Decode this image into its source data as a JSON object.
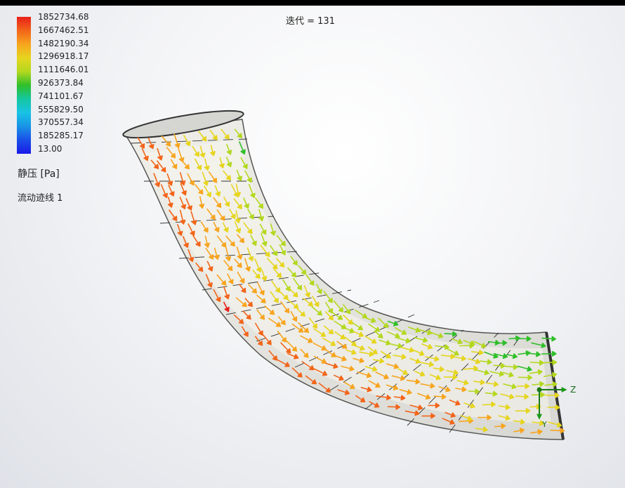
{
  "header": {
    "iteration": "迭代 = 131"
  },
  "legend": {
    "values": [
      "1852734.68",
      "1667462.51",
      "1482190.34",
      "1296918.17",
      "1111646.01",
      "926373.84",
      "741101.67",
      "555829.50",
      "370557.34",
      "185285.17",
      "13.00"
    ],
    "colors": [
      "#e8201a",
      "#f2651a",
      "#f7a51f",
      "#e6d51f",
      "#b3d81f",
      "#2fbf2a",
      "#14c7a0",
      "#19c3e6",
      "#1993e6",
      "#1a4fe8",
      "#1a1ae8"
    ],
    "quantity": "静压 [Pa]",
    "trajectory": "流动迹线 1"
  },
  "axis": {
    "z": "Z",
    "y": "Y"
  },
  "pressure_field": {
    "min": 13.0,
    "max": 1852734.68,
    "outer_wall_level": 0.95,
    "inner_wall_level": 0.55,
    "outlet_inner_level": 0.45
  }
}
